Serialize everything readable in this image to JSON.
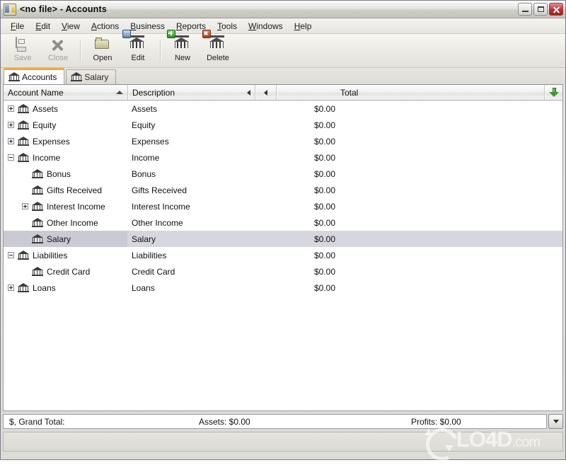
{
  "window": {
    "title": "<no file> - Accounts",
    "icon": "accounts-app-icon",
    "buttons": {
      "minimize": "minimize-button",
      "maximize": "maximize-button",
      "close": "close-button"
    }
  },
  "menubar": {
    "items": [
      {
        "label": "File",
        "accel": "F"
      },
      {
        "label": "Edit",
        "accel": "E"
      },
      {
        "label": "View",
        "accel": "V"
      },
      {
        "label": "Actions",
        "accel": "A"
      },
      {
        "label": "Business",
        "accel": "B"
      },
      {
        "label": "Reports",
        "accel": "R"
      },
      {
        "label": "Tools",
        "accel": "T"
      },
      {
        "label": "Windows",
        "accel": "W"
      },
      {
        "label": "Help",
        "accel": "H"
      }
    ]
  },
  "toolbar": {
    "items": [
      {
        "label": "Save",
        "icon": "floppy-disk-icon",
        "enabled": false
      },
      {
        "label": "Close",
        "icon": "x-close-icon",
        "enabled": false
      },
      {
        "label": "Open",
        "icon": "folder-open-icon",
        "enabled": true
      },
      {
        "label": "Edit",
        "icon": "bank-edit-icon",
        "enabled": true
      },
      {
        "label": "New",
        "icon": "bank-add-icon",
        "enabled": true
      },
      {
        "label": "Delete",
        "icon": "bank-delete-icon",
        "enabled": true
      }
    ]
  },
  "tabs": [
    {
      "label": "Accounts",
      "icon": "bank-icon",
      "active": true
    },
    {
      "label": "Salary",
      "icon": "bank-icon",
      "active": false
    }
  ],
  "grid": {
    "columns": [
      {
        "label": "Account Name",
        "sort": "ascending"
      },
      {
        "label": "Description",
        "sort": "none"
      },
      {
        "label": "Total",
        "sort": "none"
      }
    ],
    "header_icons": {
      "sort_asc": "triangle-up-icon",
      "scroll_left": "triangle-left-icon",
      "column_chooser": "green-down-arrow-icon"
    },
    "rows": [
      {
        "name": "Assets",
        "description": "Assets",
        "total": "$0.00",
        "level": 0,
        "expander": "plus",
        "selected": false
      },
      {
        "name": "Equity",
        "description": "Equity",
        "total": "$0.00",
        "level": 0,
        "expander": "plus",
        "selected": false
      },
      {
        "name": "Expenses",
        "description": "Expenses",
        "total": "$0.00",
        "level": 0,
        "expander": "plus",
        "selected": false
      },
      {
        "name": "Income",
        "description": "Income",
        "total": "$0.00",
        "level": 0,
        "expander": "minus",
        "selected": false
      },
      {
        "name": "Bonus",
        "description": "Bonus",
        "total": "$0.00",
        "level": 1,
        "expander": "none",
        "selected": false
      },
      {
        "name": "Gifts Received",
        "description": "Gifts Received",
        "total": "$0.00",
        "level": 1,
        "expander": "none",
        "selected": false
      },
      {
        "name": "Interest Income",
        "description": "Interest Income",
        "total": "$0.00",
        "level": 1,
        "expander": "plus",
        "selected": false
      },
      {
        "name": "Other Income",
        "description": "Other Income",
        "total": "$0.00",
        "level": 1,
        "expander": "none",
        "selected": false
      },
      {
        "name": "Salary",
        "description": "Salary",
        "total": "$0.00",
        "level": 1,
        "expander": "none",
        "selected": true
      },
      {
        "name": "Liabilities",
        "description": "Liabilities",
        "total": "$0.00",
        "level": 0,
        "expander": "minus",
        "selected": false
      },
      {
        "name": "Credit Card",
        "description": "Credit Card",
        "total": "$0.00",
        "level": 1,
        "expander": "none",
        "selected": false
      },
      {
        "name": "Loans",
        "description": "Loans",
        "total": "$0.00",
        "level": 0,
        "expander": "plus",
        "selected": false
      }
    ]
  },
  "statusbar": {
    "grand_total": "$, Grand Total:",
    "assets": "Assets: $0.00",
    "profits": "Profits: $0.00",
    "dropdown": "chevron-down-icon"
  },
  "watermark": {
    "text": "LO4D",
    "domain": ".com"
  },
  "colors": {
    "tab_accent": "#f0a838",
    "selection": "#d6d7de",
    "selection_name": "#c9cad4",
    "close_button": "#bb2f2f",
    "green_arrow": "#3c9a2a"
  }
}
